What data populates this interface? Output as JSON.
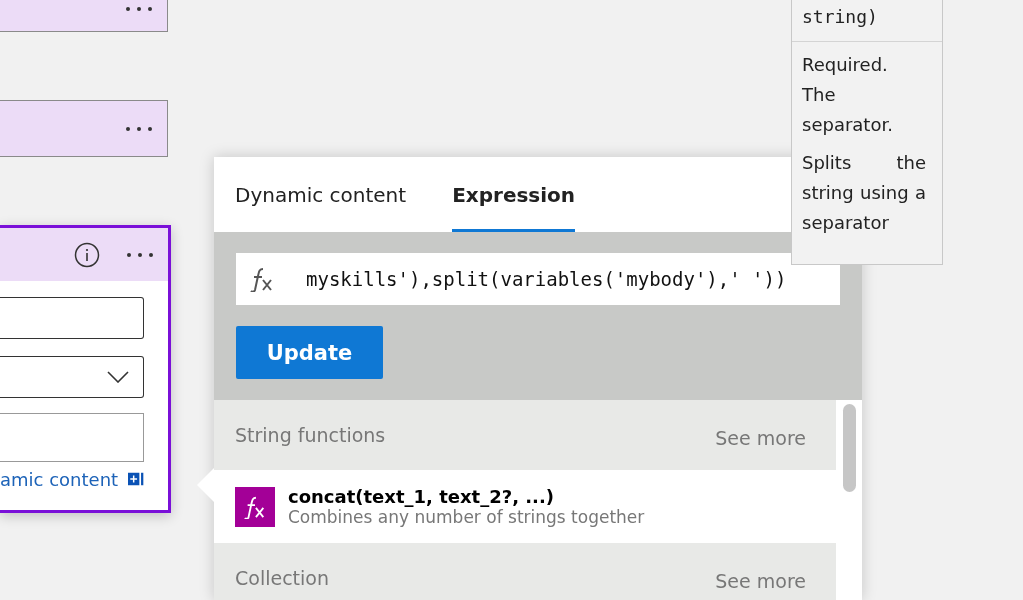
{
  "cards": [
    {
      "selected": false
    },
    {
      "selected": false
    },
    {
      "selected": true,
      "fields": [
        {
          "kind": "text"
        },
        {
          "kind": "dropdown"
        },
        {
          "kind": "text"
        }
      ],
      "link": "amic content"
    }
  ],
  "panel": {
    "tabs": [
      {
        "label": "Dynamic content",
        "selected": false
      },
      {
        "label": "Expression",
        "selected": true
      }
    ],
    "expression": {
      "value": "myskills'),split(variables('mybody'),' '))"
    },
    "button": "Update",
    "list": [
      {
        "kind": "header",
        "title": "String functions",
        "action": "See more"
      },
      {
        "kind": "function",
        "name": "concat(text_1, text_2?, ...)",
        "description": "Combines any number of strings together"
      },
      {
        "kind": "header",
        "title": "Collection",
        "action": "See more"
      }
    ]
  },
  "tooltip": {
    "signature_tail": "string)",
    "paragraphs": [
      "Required. The separator.",
      "Splits the string using a separator"
    ]
  }
}
